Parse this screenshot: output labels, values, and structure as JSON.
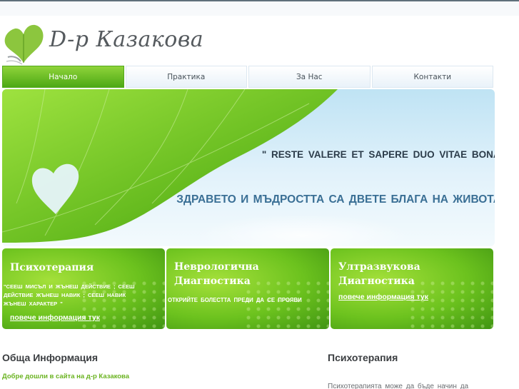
{
  "logo": {
    "text": "D-р Казакова",
    "icon": "ginkgo-leaf-icon"
  },
  "nav": {
    "items": [
      {
        "label": "Начало",
        "active": true
      },
      {
        "label": "Практика",
        "active": false
      },
      {
        "label": "За Нас",
        "active": false
      },
      {
        "label": "Контакти",
        "active": false
      }
    ]
  },
  "hero": {
    "quote": "\" RESTE  VALERE  ET  SAPERE  DUO  VITAE  BONA\"",
    "slogan": "ЗДРАВЕТО И МЪДРОСТТА  СА ДВЕТЕ БЛАГА  НА  ЖИВОТА"
  },
  "boxes": [
    {
      "title": "Психотерапия",
      "text_lines": [
        "\"СЕЕШ  МИСЪЛ  И  ЖЪНЕШ  ДЕЙСТВИЕ ; СЕЕШ",
        "ДЕЙСТВИЕ  ЖЪНЕШ  НАВИК ; СЕЕШ  НАВИК",
        "ЖЪНЕШ  ХАРАКТЕР \""
      ],
      "link": "повече информация тук"
    },
    {
      "title_lines": [
        "Неврологична",
        "Диагностика"
      ],
      "text": "ОТКРИЙТЕ  БОЛЕСТТА  ПРЕДИ  ДА СЕ ПРОЯВИ"
    },
    {
      "title_lines": [
        "Ултразвукова",
        "Диагностика"
      ],
      "link": "повече информация тук"
    }
  ],
  "content": {
    "general_title": "Обща Информация",
    "welcome": "Добре  дошли  в сайта на д-р Казакова",
    "psy_title": "Психотерапия",
    "psy_intro": "Психотерапията  може  да  бъде  начин  да"
  },
  "colors": {
    "accent_green": "#6cc21e",
    "nav_active": "#4da915",
    "slogan_blue": "#3a6f95"
  }
}
